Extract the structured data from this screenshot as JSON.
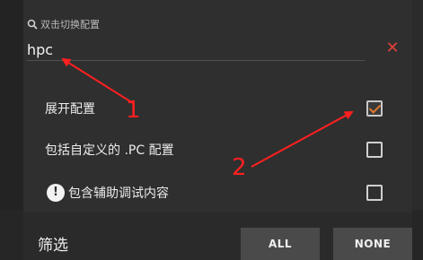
{
  "search": {
    "hint": "双击切换配置",
    "value": "hpc",
    "clear_symbol": "✕"
  },
  "options": [
    {
      "label": "展开配置",
      "checked": true
    },
    {
      "label": "包括自定义的 .PC 配置",
      "checked": false
    },
    {
      "label": "包含辅助调试内容",
      "checked": false,
      "icon": "info-icon"
    }
  ],
  "footer": {
    "label": "筛选",
    "all_label": "ALL",
    "none_label": "NONE"
  },
  "annotations": [
    {
      "number": "1"
    },
    {
      "number": "2"
    }
  ],
  "colors": {
    "accent_check": "#e07a2e",
    "clear": "#e0403a",
    "annotation": "#ff2020"
  }
}
